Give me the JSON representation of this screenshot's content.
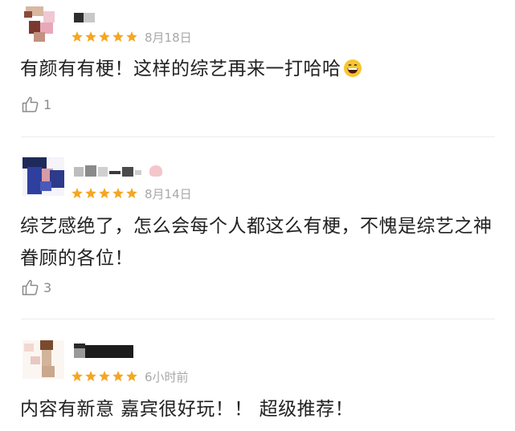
{
  "reviews": [
    {
      "rating": 5,
      "date": "8月18日",
      "content": "有颜有有梗！这样的综艺再来一打哈哈",
      "emoji": "grinning-face-emoji",
      "likes": "1"
    },
    {
      "rating": 5,
      "date": "8月14日",
      "content": "综艺感绝了，怎么会每个人都这么有梗，不愧是综艺之神眷顾的各位！",
      "likes": "3"
    },
    {
      "rating": 5,
      "date": "6小时前",
      "content": "内容有新意 嘉宾很好玩！！ 超级推荐！"
    }
  ],
  "colors": {
    "star": "#f5a623",
    "date": "#a8a8a8",
    "text": "#222222",
    "like_icon": "#8a8a8a",
    "divider": "#ececec"
  },
  "icons": {
    "star": "star-icon",
    "like": "thumbs-up-icon",
    "emoji": "grinning-face-emoji"
  }
}
